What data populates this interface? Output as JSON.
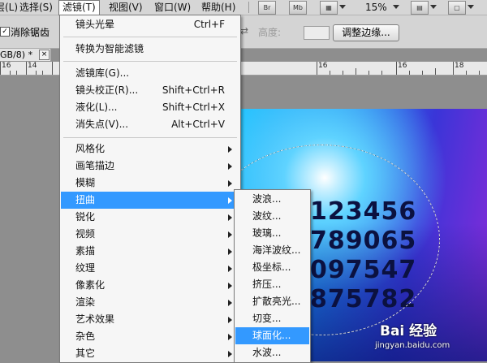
{
  "menubar": {
    "items": [
      {
        "label": "层(L)"
      },
      {
        "label": "选择(S)"
      },
      {
        "label": "滤镜(T)"
      },
      {
        "label": "视图(V)"
      },
      {
        "label": "窗口(W)"
      },
      {
        "label": "帮助(H)"
      }
    ],
    "tool_buttons": [
      {
        "label": "Br"
      },
      {
        "label": "Mb"
      }
    ],
    "zoom": "15%"
  },
  "options_bar": {
    "antialias_checkbox": "✓",
    "antialias_label": "消除锯齿",
    "height_label": "高度:",
    "height_value": "",
    "refine_edge_button": "调整边缘..."
  },
  "document": {
    "tab_label": "GB/8) *",
    "tab_close": "×"
  },
  "ruler": {
    "labels": [
      "16",
      "14",
      "16",
      "16",
      "18"
    ]
  },
  "canvas": {
    "number_lines": [
      "123456",
      "789065",
      "097547",
      "875782"
    ]
  },
  "filter_menu": {
    "items": [
      {
        "label": "镜头光晕",
        "shortcut": "Ctrl+F"
      },
      {
        "label": "转换为智能滤镜",
        "shortcut": ""
      },
      {
        "label": "滤镜库(G)...",
        "shortcut": ""
      },
      {
        "label": "镜头校正(R)...",
        "shortcut": "Shift+Ctrl+R"
      },
      {
        "label": "液化(L)...",
        "shortcut": "Shift+Ctrl+X"
      },
      {
        "label": "消失点(V)...",
        "shortcut": "Alt+Ctrl+V"
      },
      {
        "label": "风格化",
        "shortcut": ""
      },
      {
        "label": "画笔描边",
        "shortcut": ""
      },
      {
        "label": "模糊",
        "shortcut": ""
      },
      {
        "label": "扭曲",
        "shortcut": ""
      },
      {
        "label": "锐化",
        "shortcut": ""
      },
      {
        "label": "视频",
        "shortcut": ""
      },
      {
        "label": "素描",
        "shortcut": ""
      },
      {
        "label": "纹理",
        "shortcut": ""
      },
      {
        "label": "像素化",
        "shortcut": ""
      },
      {
        "label": "渲染",
        "shortcut": ""
      },
      {
        "label": "艺术效果",
        "shortcut": ""
      },
      {
        "label": "杂色",
        "shortcut": ""
      },
      {
        "label": "其它",
        "shortcut": ""
      }
    ]
  },
  "distort_submenu": {
    "items": [
      {
        "label": "波浪..."
      },
      {
        "label": "波纹..."
      },
      {
        "label": "玻璃..."
      },
      {
        "label": "海洋波纹..."
      },
      {
        "label": "极坐标..."
      },
      {
        "label": "挤压..."
      },
      {
        "label": "扩散亮光..."
      },
      {
        "label": "切变..."
      },
      {
        "label": "球面化..."
      },
      {
        "label": "水波..."
      }
    ]
  },
  "watermark": {
    "logo": "Bai 经验",
    "url": "jingyan.baidu.com"
  },
  "colors": {
    "highlight": "#3399ff",
    "menu_bg": "#f6f6f6",
    "workspace": "#8e8e8e"
  }
}
